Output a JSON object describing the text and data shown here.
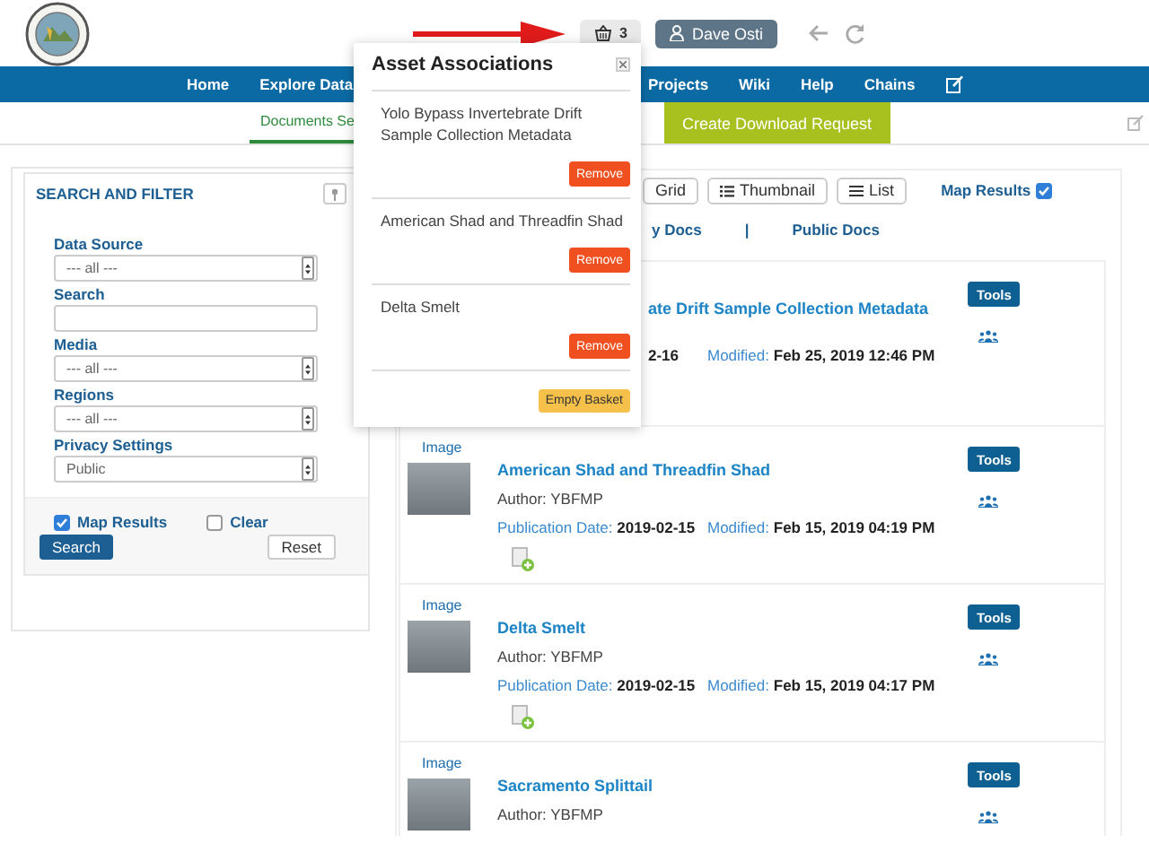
{
  "header": {
    "basket_count": "3",
    "user": "Dave Osti"
  },
  "nav": {
    "left_items": [
      "Home",
      "Explore Data"
    ],
    "right_items": [
      "Projects",
      "Wiki",
      "Help",
      "Chains"
    ]
  },
  "subnav": {
    "tabs": [
      {
        "label": "Documents Se",
        "selected": true
      }
    ],
    "action": "Create Download Request"
  },
  "filter": {
    "title": "SEARCH AND FILTER",
    "fields": [
      {
        "kind": "select",
        "label": "Data Source",
        "value": "--- all ---"
      },
      {
        "kind": "text",
        "label": "Search"
      },
      {
        "kind": "select",
        "label": "Media",
        "value": "--- all ---"
      },
      {
        "kind": "select",
        "label": "Regions",
        "value": "--- all ---"
      },
      {
        "kind": "select",
        "label": "Privacy Settings",
        "value": "Public"
      }
    ],
    "options": [
      {
        "label": "Map Results",
        "checked": true
      },
      {
        "label": "Clear",
        "checked": false
      }
    ],
    "buttons": [
      "Search",
      "Reset"
    ]
  },
  "results": {
    "views": [
      "Grid",
      "Thumbnail",
      "List"
    ],
    "map_results": {
      "label": "Map Results",
      "checked": true
    },
    "tabs": [
      "y Docs",
      "Public Docs"
    ],
    "separator": "|",
    "docs": [
      {
        "title": "ate Drift Sample Collection Metadata",
        "publication_date": "2-16",
        "modified_label": "Modified:",
        "modified": "Feb 25, 2019 12:46 PM",
        "tools": "Tools"
      },
      {
        "media": "Image",
        "title": "American Shad and Threadfin Shad",
        "author": "Author: YBFMP",
        "publication_label": "Publication Date:",
        "publication_date": "2019-02-15",
        "modified_label": "Modified:",
        "modified": "Feb 15, 2019 04:19 PM",
        "tools": "Tools"
      },
      {
        "media": "Image",
        "title": "Delta Smelt",
        "author": "Author: YBFMP",
        "publication_label": "Publication Date:",
        "publication_date": "2019-02-15",
        "modified_label": "Modified:",
        "modified": "Feb 15, 2019 04:17 PM",
        "tools": "Tools"
      },
      {
        "media": "Image",
        "title": "Sacramento Splittail",
        "author": "Author: YBFMP",
        "tools": "Tools"
      }
    ]
  },
  "basket": {
    "title": "Asset Associations",
    "items": [
      {
        "name": "Yolo Bypass Invertebrate Drift Sample Collection Metadata",
        "action": "Remove"
      },
      {
        "name": "American Shad and Threadfin Shad",
        "action": "Remove"
      },
      {
        "name": "Delta Smelt",
        "action": "Remove"
      }
    ],
    "empty_button": "Empty Basket"
  }
}
